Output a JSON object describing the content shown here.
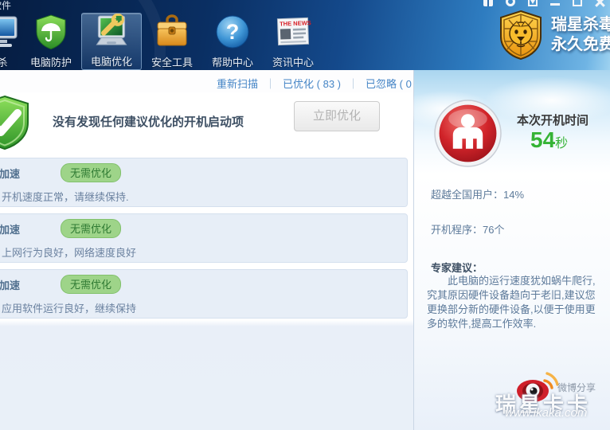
{
  "window": {
    "title": "杀毒软件"
  },
  "toolbar": {
    "items": [
      {
        "label": "杀"
      },
      {
        "label": "电脑防护"
      },
      {
        "label": "电脑优化"
      },
      {
        "label": "安全工具"
      },
      {
        "label": "帮助中心"
      },
      {
        "label": "资讯中心"
      }
    ],
    "news_icon_text": "THE NEWS",
    "help_icon_mark": "?",
    "brand_title": "瑞星杀毒",
    "brand_subtitle": "永久免费"
  },
  "tabs": {
    "rescan": "重新扫描",
    "optimized": "已优化 ( 83 )",
    "ignored": "已忽略 ( 0 )",
    "separator": "｜"
  },
  "main": {
    "status_message": "没有发现任何建议优化的开机启动项",
    "optimize_button": "立即优化",
    "items": [
      {
        "title": "加速",
        "badge": "无需优化",
        "desc": "开机速度正常，请继续保持."
      },
      {
        "title": "加速",
        "badge": "无需优化",
        "desc": "上网行为良好，网络速度良好"
      },
      {
        "title": "加速",
        "badge": "无需优化",
        "desc": "应用软件运行良好，继续保持"
      }
    ]
  },
  "sidebar": {
    "boot_time_label": "本次开机时间",
    "boot_time_value": "54",
    "boot_time_unit": "秒",
    "stat_users": "超越全国用户：14%",
    "stat_programs": "开机程序：76个",
    "expert_title": "专家建议：",
    "expert_text": "此电脑的运行速度犹如蜗牛爬行,究其原因硬件设备趋向于老旧,建议您更换部分新的硬件设备,以便于使用更多的软件,提高工作效率."
  },
  "footer": {
    "weibo_share": "微博分享",
    "watermark_name": "瑞星卡卡",
    "watermark_url": "www.ikaka.com"
  },
  "colors": {
    "accent_green": "#36b139",
    "badge_bg": "#9ed489",
    "tab_link": "#4585c6",
    "brand_gold": "#f3a81c",
    "toolbar_navy": "#0a2f63"
  }
}
